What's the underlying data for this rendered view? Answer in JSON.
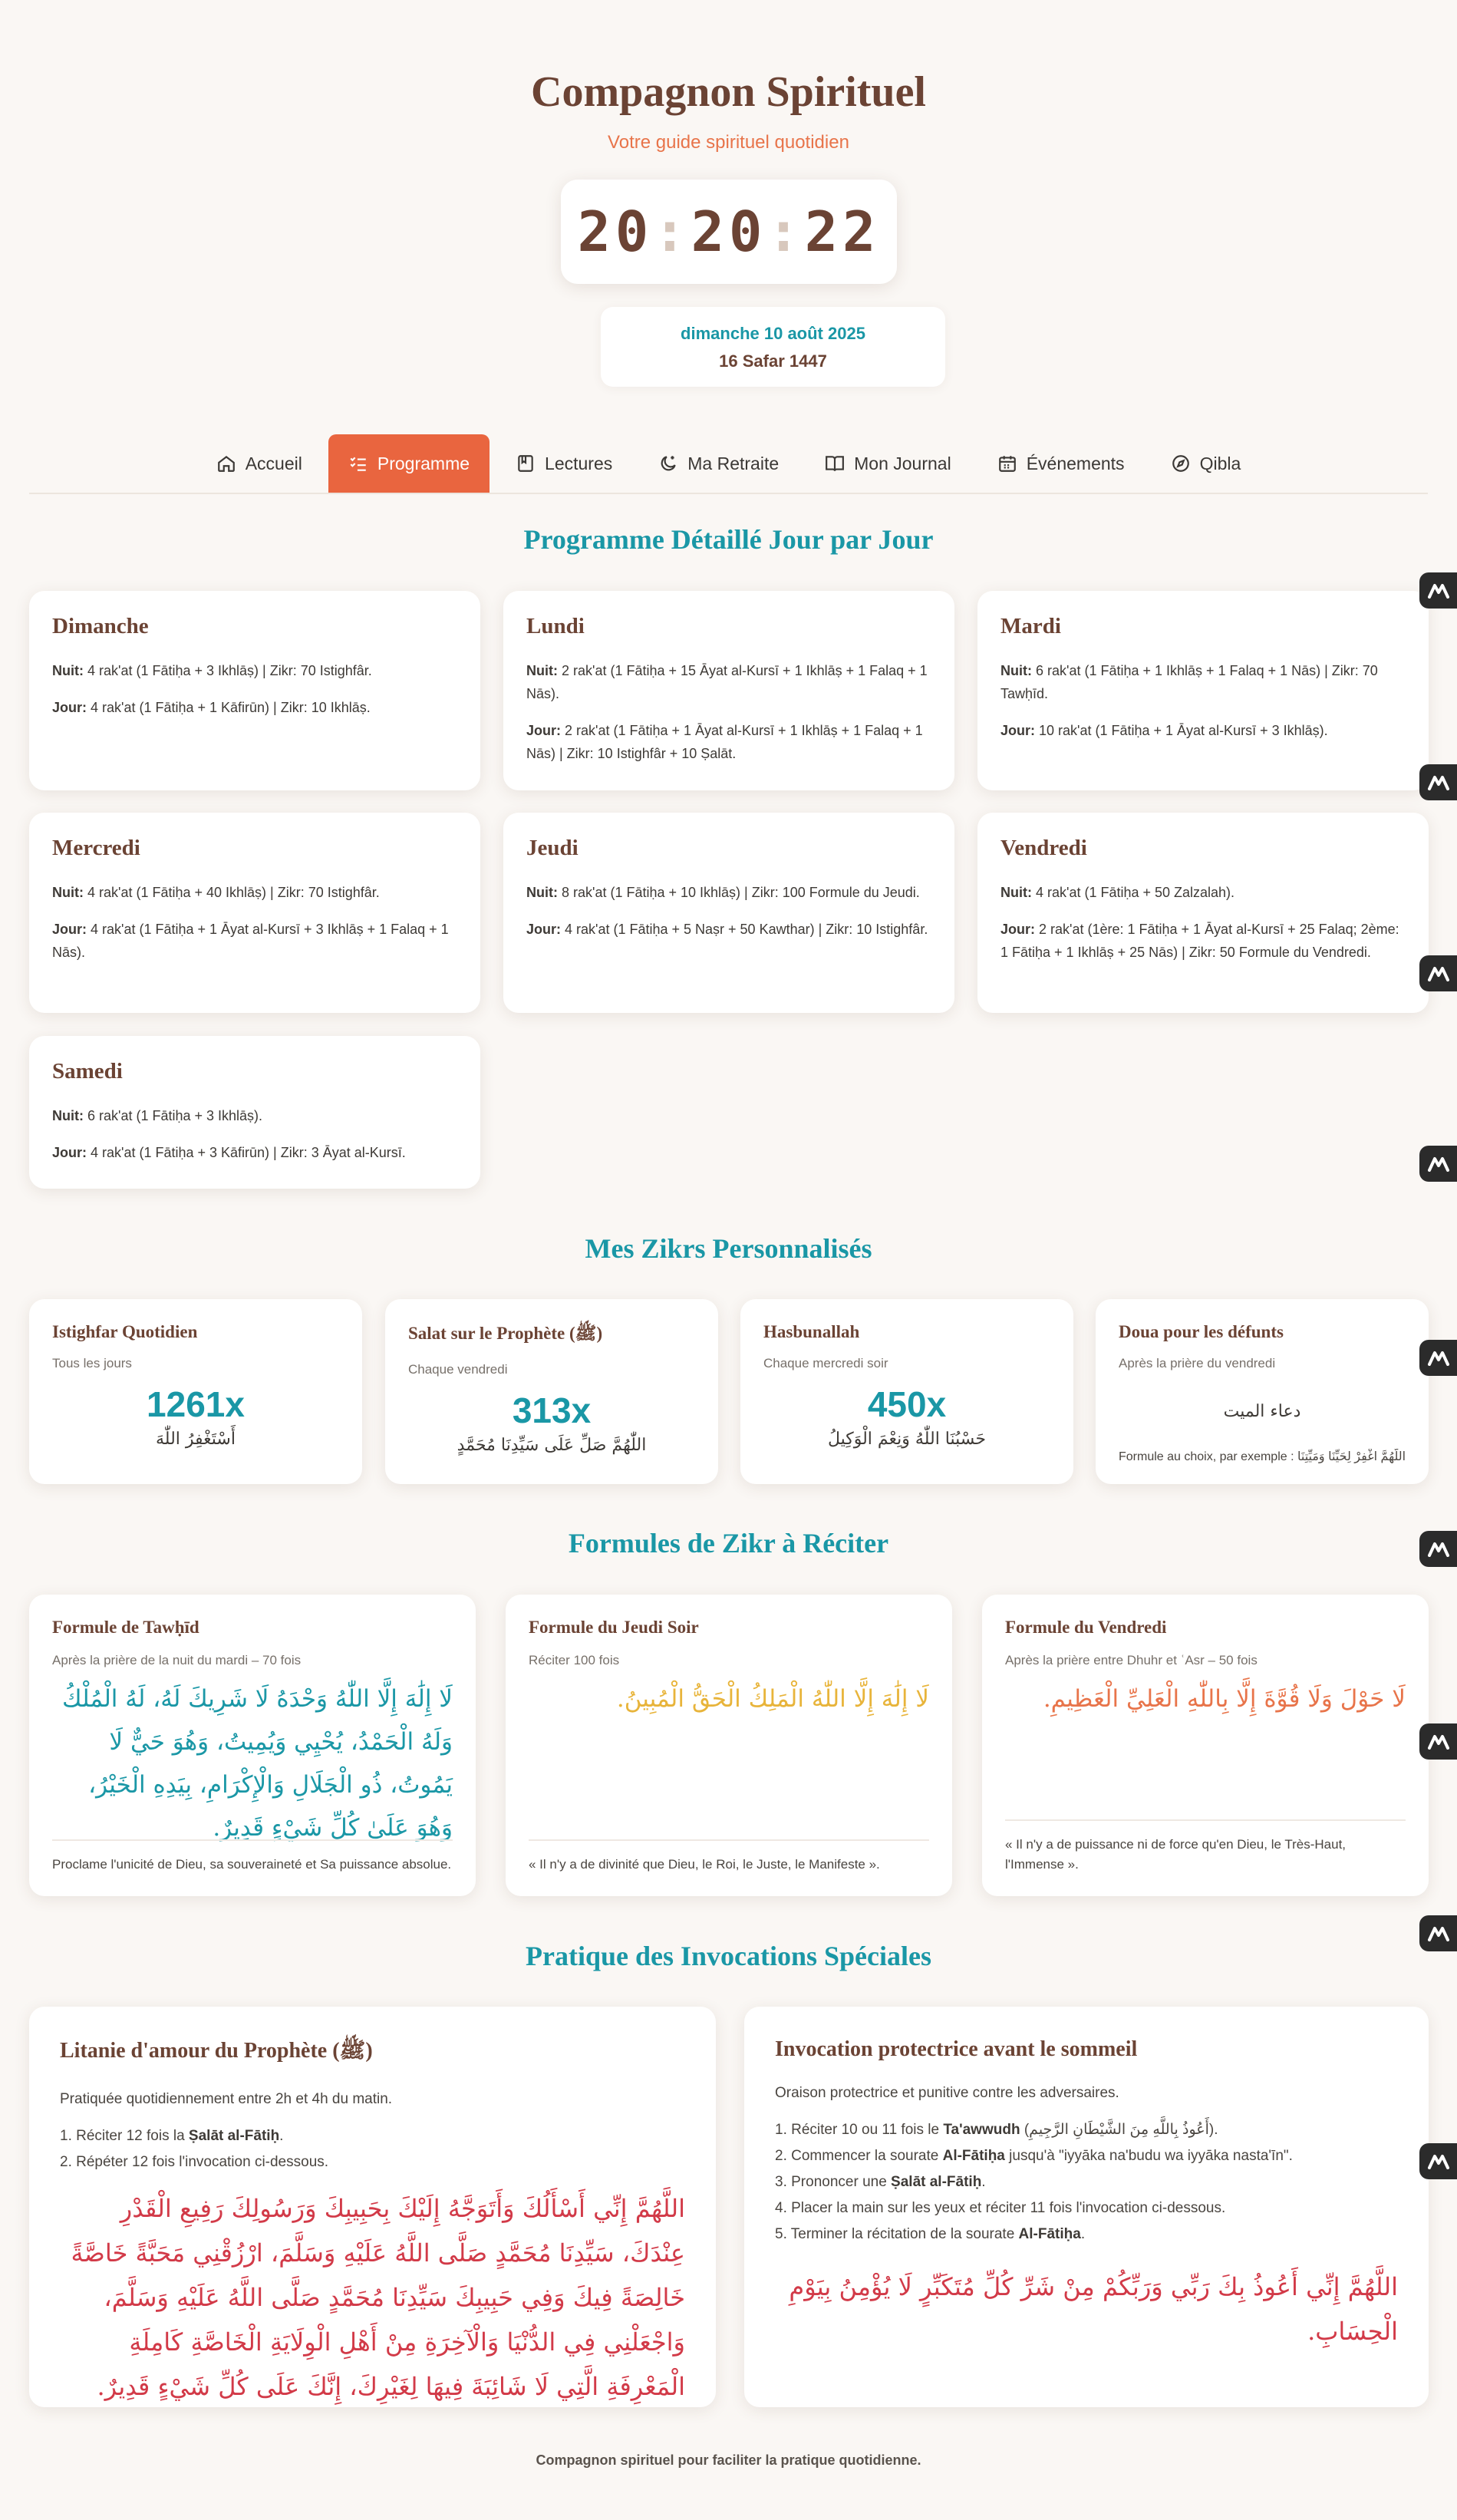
{
  "header": {
    "title": "Compagnon Spirituel",
    "subtitle": "Votre guide spirituel quotidien",
    "clock": {
      "h": "20",
      "m": "20",
      "s": "22",
      "sep": ":"
    },
    "date_gregorian": "dimanche 10 août 2025",
    "date_hijri": "16 Safar 1447"
  },
  "nav": {
    "items": [
      {
        "label": "Accueil",
        "icon": "home-icon"
      },
      {
        "label": "Programme",
        "icon": "checklist-icon",
        "active": true
      },
      {
        "label": "Lectures",
        "icon": "book-icon"
      },
      {
        "label": "Ma Retraite",
        "icon": "moon-icon"
      },
      {
        "label": "Mon Journal",
        "icon": "open-book-icon"
      },
      {
        "label": "Événements",
        "icon": "calendar-icon"
      },
      {
        "label": "Qibla",
        "icon": "compass-icon"
      }
    ]
  },
  "programme": {
    "title": "Programme Détaillé Jour par Jour",
    "days": [
      {
        "name": "Dimanche",
        "nuit_label": "Nuit:",
        "nuit": " 4 rak'at (1 Fātiḥa + 3 Ikhlāṣ) | Zikr: 70 Istighfâr.",
        "jour_label": "Jour:",
        "jour": " 4 rak'at (1 Fātiḥa + 1 Kāfirūn) | Zikr: 10 Ikhlāṣ."
      },
      {
        "name": "Lundi",
        "nuit_label": "Nuit:",
        "nuit": " 2 rak'at (1 Fātiḥa + 15 Āyat al-Kursī + 1 Ikhlāṣ + 1 Falaq + 1 Nās).",
        "jour_label": "Jour:",
        "jour": " 2 rak'at (1 Fātiḥa + 1 Āyat al-Kursī + 1 Ikhlāṣ + 1 Falaq + 1 Nās) | Zikr: 10 Istighfâr + 10 Ṣalāt."
      },
      {
        "name": "Mardi",
        "nuit_label": "Nuit:",
        "nuit": " 6 rak'at (1 Fātiḥa + 1 Ikhlāṣ + 1 Falaq + 1 Nās) | Zikr: 70 Tawḥīd.",
        "jour_label": "Jour:",
        "jour": " 10 rak'at (1 Fātiḥa + 1 Āyat al-Kursī + 3 Ikhlāṣ)."
      },
      {
        "name": "Mercredi",
        "nuit_label": "Nuit:",
        "nuit": " 4 rak'at (1 Fātiḥa + 40 Ikhlāṣ) | Zikr: 70 Istighfâr.",
        "jour_label": "Jour:",
        "jour": " 4 rak'at (1 Fātiḥa + 1 Āyat al-Kursī + 3 Ikhlāṣ + 1 Falaq + 1 Nās)."
      },
      {
        "name": "Jeudi",
        "nuit_label": "Nuit:",
        "nuit": " 8 rak'at (1 Fātiḥa + 10 Ikhlāṣ) | Zikr: 100 Formule du Jeudi.",
        "jour_label": "Jour:",
        "jour": " 4 rak'at (1 Fātiḥa + 5 Naṣr + 50 Kawthar) | Zikr: 10 Istighfâr."
      },
      {
        "name": "Vendredi",
        "nuit_label": "Nuit:",
        "nuit": " 4 rak'at (1 Fātiḥa + 50 Zalzalah).",
        "jour_label": "Jour:",
        "jour": " 2 rak'at (1ère: 1 Fātiḥa + 1 Āyat al-Kursī + 25 Falaq; 2ème: 1 Fātiḥa + 1 Ikhlāṣ + 25 Nās) | Zikr: 50 Formule du Vendredi."
      },
      {
        "name": "Samedi",
        "nuit_label": "Nuit:",
        "nuit": " 6 rak'at (1 Fātiḥa + 3 Ikhlāṣ).",
        "jour_label": "Jour:",
        "jour": " 4 rak'at (1 Fātiḥa + 3 Kāfirūn) | Zikr: 3 Āyat al-Kursī."
      }
    ]
  },
  "zikrs": {
    "title": "Mes Zikrs Personnalisés",
    "items": [
      {
        "title": "Istighfar Quotidien",
        "schedule": "Tous les jours",
        "count": "1261x",
        "arabic": "أَسْتَغْفِرُ اللّٰهَ"
      },
      {
        "title": "Salat sur le Prophète (ﷺ)",
        "schedule": "Chaque vendredi",
        "count": "313x",
        "arabic": "اللّٰهُمَّ صَلِّ عَلَى سَيِّدِنَا مُحَمَّدٍ"
      },
      {
        "title": "Hasbunallah",
        "schedule": "Chaque mercredi soir",
        "count": "450x",
        "arabic": "حَسْبُنَا اللّٰهُ وَنِعْمَ الْوَكِيلُ"
      },
      {
        "title": "Doua pour les défunts",
        "schedule": "Après la prière du vendredi",
        "arabic": "دعاء الميت",
        "note": "Formule au choix, par exemple : اللَّهُمَّ اغْفِرْ لِحَيِّنَا وَمَيِّتِنَا..."
      }
    ]
  },
  "formules": {
    "title": "Formules de Zikr à Réciter",
    "items": [
      {
        "title": "Formule de Tawḥīd",
        "schedule": "Après la prière de la nuit du mardi – 70 fois",
        "arabic": "لَا إِلَٰهَ إِلَّا اللّٰهُ وَحْدَهُ لَا شَرِيكَ لَهُ، لَهُ الْمُلْكُ وَلَهُ الْحَمْدُ، يُحْيِي وَيُمِيتُ، وَهُوَ حَيٌّ لَا يَمُوتُ، ذُو الْجَلَالِ وَالْإِكْرَامِ، بِيَدِهِ الْخَيْرُ، وَهُوَ عَلَىٰ كُلِّ شَيْءٍ قَدِيرٌ.",
        "translation": "Proclame l'unicité de Dieu, sa souveraineté et Sa puissance absolue.",
        "color": "#1a97a6"
      },
      {
        "title": "Formule du Jeudi Soir",
        "schedule": "Réciter 100 fois",
        "arabic": "لَا إِلَٰهَ إِلَّا اللّٰهُ الْمَلِكُ الْحَقُّ الْمُبِينُ.",
        "translation": "« Il n'y a de divinité que Dieu, le Roi, le Juste, le Manifeste ».",
        "color": "#e8b43a"
      },
      {
        "title": "Formule du Vendredi",
        "schedule": "Après la prière entre Dhuhr et ʿAsr – 50 fois",
        "arabic": "لَا حَوْلَ وَلَا قُوَّةَ إِلَّا بِاللّٰهِ الْعَلِيِّ الْعَظِيمِ.",
        "translation": "« Il n'y a de puissance ni de force qu'en Dieu, le Très-Haut, l'Immense ».",
        "color": "#e8744a"
      }
    ]
  },
  "invocations": {
    "title": "Pratique des Invocations Spéciales",
    "items": [
      {
        "title": "Litanie d'amour du Prophète (ﷺ)",
        "desc": "Pratiquée quotidiennement entre 2h et 4h du matin.",
        "steps": [
          {
            "pre": "1. Réciter 12 fois la ",
            "bold": "Ṣalāt al-Fātiḥ",
            "post": "."
          },
          {
            "pre": "2. Répéter 12 fois l'invocation ci-dessous.",
            "bold": "",
            "post": ""
          }
        ],
        "arabic": "اللَّهُمَّ إِنِّي أَسْأَلُكَ وَأَتَوَجَّهُ إِلَيْكَ بِحَبِيبِكَ وَرَسُولِكَ رَفِيعِ الْقَدْرِ عِنْدَكَ، سَيِّدِنَا مُحَمَّدٍ صَلَّى اللَّهُ عَلَيْهِ وَسَلَّمَ، ارْزُقْنِي مَحَبَّةً خَاصَّةً خَالِصَةً فِيكَ وَفِي حَبِيبِكَ سَيِّدِنَا مُحَمَّدٍ صَلَّى اللَّهُ عَلَيْهِ وَسَلَّمَ، وَاجْعَلْنِي فِي الدُّنْيَا وَالْآخِرَةِ مِنْ أَهْلِ الْوِلَايَةِ الْخَاصَّةِ كَامِلَةِ الْمَعْرِفَةِ الَّتِي لَا شَائِبَةَ فِيهَا لِغَيْرِكَ، إِنَّكَ عَلَى كُلِّ شَيْءٍ قَدِيرٌ."
      },
      {
        "title": "Invocation protectrice avant le sommeil",
        "desc": "Oraison protectrice et punitive contre les adversaires.",
        "steps": [
          {
            "pre": "1. Réciter 10 ou 11 fois le ",
            "bold": "Ta'awwudh",
            "post": " (أَعُوذُ بِاللَّهِ مِنَ الشَّيْطَانِ الرَّجِيمِ)."
          },
          {
            "pre": "2. Commencer la sourate ",
            "bold": "Al-Fātiḥa",
            "post": " jusqu'à \"iyyāka na'budu wa iyyāka nasta'īn\"."
          },
          {
            "pre": "3. Prononcer une ",
            "bold": "Ṣalāt al-Fātiḥ",
            "post": "."
          },
          {
            "pre": "4. Placer la main sur les yeux et réciter 11 fois l'invocation ci-dessous.",
            "bold": "",
            "post": ""
          },
          {
            "pre": "5. Terminer la récitation de la sourate ",
            "bold": "Al-Fātiḥa",
            "post": "."
          }
        ],
        "arabic": "اللَّهُمَّ إِنِّي أَعُوذُ بِكَ رَبِّي وَرَبِّكُمْ مِنْ شَرِّ كُلِّ مُتَكَبِّرٍ لَا يُؤْمِنُ بِيَوْمِ الْحِسَابِ."
      }
    ]
  },
  "footer": "Compagnon spirituel pour faciliter la pratique quotidienne."
}
